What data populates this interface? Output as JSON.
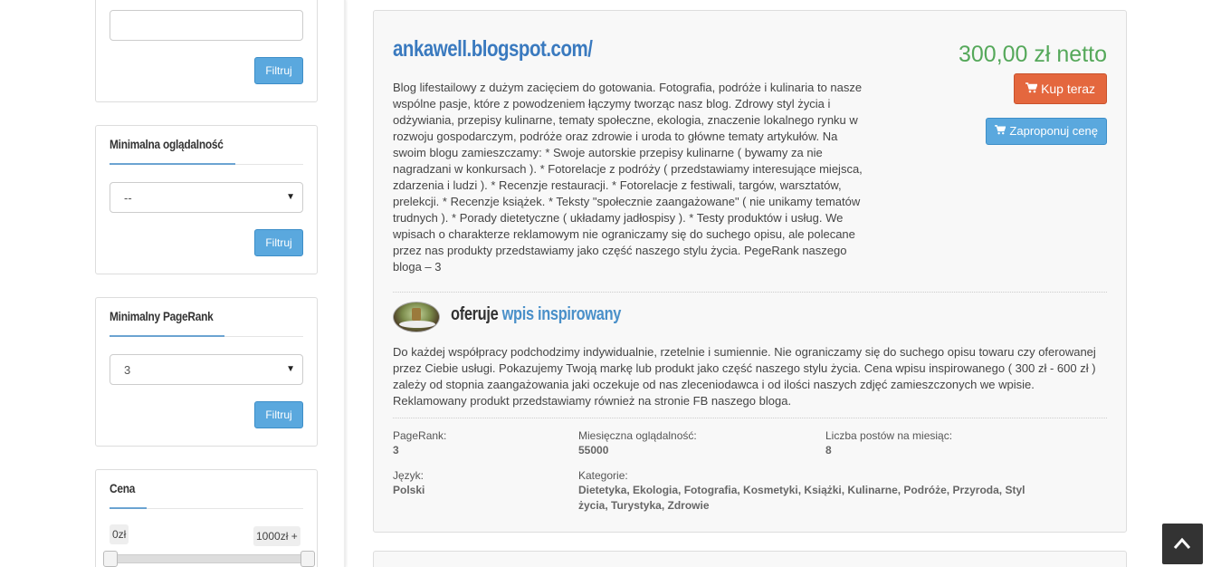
{
  "sidebar": {
    "widget_top": {
      "filter_button": "Filtruj"
    },
    "views": {
      "title": "Minimalna oglądalność",
      "selected": "--",
      "filter_button": "Filtruj"
    },
    "pagerank": {
      "title": "Minimalny PageRank",
      "selected": "3",
      "filter_button": "Filtruj"
    },
    "price": {
      "title": "Cena",
      "min_label": "0zł",
      "max_label": "1000zł +"
    }
  },
  "listing": {
    "title": "ankawell.blogspot.com/",
    "price": "300,00 zł netto",
    "buy_button": "Kup teraz",
    "offer_button": "Zaproponuj cenę",
    "description": "Blog lifestailowy z dużym zacięciem do gotowania. Fotografia, podróże i kulinaria to nasze wspólne pasje, które z powodzeniem łączymy tworząc nasz blog. Zdrowy styl życia i odżywiania, przepisy kulinarne, tematy społeczne, ekologia, znaczenie lokalnego rynku w rozwoju gospodarczym, podróże oraz zdrowie i uroda to główne tematy artykułów. Na swoim blogu zamieszczamy: * Swoje autorskie przepisy kulinarne ( bywamy za nie nagradzani w konkursach ). * Fotorelacje z podróży ( przedstawiamy interesujące miejsca, zdarzenia i ludzi ). * Recenzje restauracji. * Fotorelacje z festiwali, targów, warsztatów, prelekcji. * Recenzje książek. * Teksty \"społecznie zaangażowane\" ( nie unikamy tematów trudnych ). * Porady dietetyczne ( układamy jadłospisy ). * Testy produktów i usług. We wpisach o charakterze reklamowym nie ograniczamy się do suchego opisu, ale polecane przez nas produkty przedstawiamy jako część naszego stylu życia. PegeRank naszego bloga – 3",
    "offer_prefix": "oferuje",
    "offer_type": "wpis inspirowany",
    "offer_description": "Do każdej współpracy podchodzimy indywidualnie, rzetelnie i sumiennie. Nie ograniczamy się do suchego opisu towaru czy oferowanej przez Ciebie usługi. Pokazujemy Twoją markę lub produkt jako część naszego stylu życia. Cena wpisu inspirowanego ( 300 zł - 600 zł ) zależy od stopnia zaangażowania jaki oczekuje od nas zleceniodawca i od ilości naszych zdjęć zamieszczonych we wpisie. Reklamowany produkt przedstawiamy również na stronie FB naszego bloga.",
    "meta": {
      "pagerank_label": "PageRank:",
      "pagerank_value": "3",
      "views_label": "Miesięczna oglądalność:",
      "views_value": "55000",
      "posts_label": "Liczba postów na miesiąc:",
      "posts_value": "8",
      "lang_label": "Język:",
      "lang_value": "Polski",
      "categories_label": "Kategorie:",
      "categories_value": "Dietetyka, Ekologia, Fotografia, Kosmetyki, Książki, Kulinarne, Podróże, Przyroda, Styl życia, Turystyka, Zdrowie"
    }
  },
  "colors": {
    "accent": "#4a90c9",
    "buy": "#e4673e",
    "price": "#55a85a"
  },
  "icons": {
    "cart": "cart-icon",
    "scroll_top": "chevron-up-icon"
  }
}
